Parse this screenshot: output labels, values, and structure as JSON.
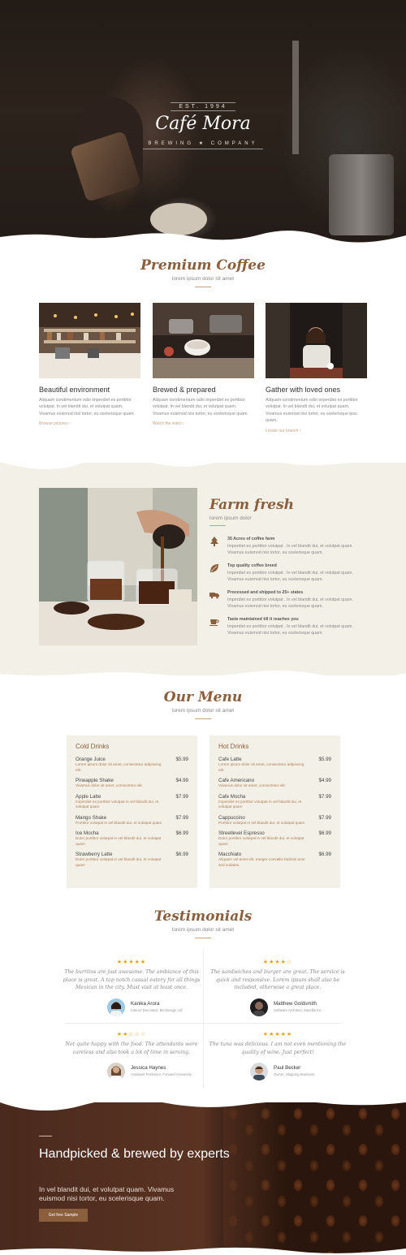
{
  "hero": {
    "est": "EST. 1994",
    "brand": "Café Mora",
    "brand_sub": "BREWING ★ COMPANY"
  },
  "premium": {
    "title": "Premium Coffee",
    "subtitle": "lorem ipsum dolor sit amet",
    "features": [
      {
        "title": "Beautiful environment",
        "text": "Aliquam condimentum odio imperdiet es porttitor volutpat. In vel blandit dui, et volutpat quam. Vivamus euismod nisi tortor, eu scelerisque quam.",
        "link": "Browse pictures ›"
      },
      {
        "title": "Brewed & prepared",
        "text": "Aliquam condimentum odio imperdiet es porttitor volutpat. In vel blandit dui, et volutpat quam. Vivamus euismod nisi tortor, eu scelerisque quam.",
        "link": "Watch the video ›"
      },
      {
        "title": "Gather with loved ones",
        "text": "Aliquam condimentum odio imperdiet es porttitor volutpat. In vel blandit dui, et volutpat quam. Vivamus euismod nisi tortor, eu scelerisque ipsu quam.",
        "link": "Locate our branch ›"
      }
    ]
  },
  "farm": {
    "title": "Farm fresh",
    "subtitle": "lorem ipsum dolor",
    "items": [
      {
        "icon": "tree-icon",
        "title": "35 Acres of coffee farm",
        "text": "Imperdiet es porttitor volutpat . In vel blandit dui, et volutpat quam. Vivamus euismod nisi tortor, eu scelerisque quam."
      },
      {
        "icon": "leaf-icon",
        "title": "Top quality coffee breed",
        "text": "Imperdiet es porttitor volutpat . In vel blandit dui, et volutpat quam. Vivamus euismod nisi tortor, eu scelerisque quam."
      },
      {
        "icon": "truck-icon",
        "title": "Processed and shipped to 25+ states",
        "text": "Imperdiet es porttitor volutpat . In vel blandit dui, et volutpat quam. Vivamus euismod nisi tortor, eu scelerisque quam."
      },
      {
        "icon": "cup-icon",
        "title": "Taste maintained till it reaches you",
        "text": "Imperdiet es porttitor volutpat . In vel blandit dui, et volutpat quam. Vivamus euismod nisi tortor, eu scelerisque quam."
      }
    ]
  },
  "menu": {
    "title": "Our Menu",
    "subtitle": "lorem ipsum dolor sit amet",
    "cold": {
      "heading": "Cold Drinks",
      "items": [
        {
          "name": "Orange Juice",
          "price": "$5.99",
          "desc": "Lorem ipsum dolor sit amet, consectetur adipiscing elit."
        },
        {
          "name": "Pineapple Shake",
          "price": "$4.99",
          "desc": "Vivamus dolor sit amet, consectetur elit."
        },
        {
          "name": "Apple Latte",
          "price": "$7.99",
          "desc": "Imperdiet es porttitor volutpat in vel blandit dui, et volutpat quam"
        },
        {
          "name": "Mango Shake",
          "price": "$7.99",
          "desc": "Porttitor volutpat in vel blandit dui, et volutpat quam"
        },
        {
          "name": "Ice Mocha",
          "price": "$6.99",
          "desc": "Dolor porttitor volutpat in vel blandit dui, et volutpat quam"
        },
        {
          "name": "Strawberry Latte",
          "price": "$6.99",
          "desc": "Dolor porttitor volutpat in vel blandit dui, et volutpat quam"
        }
      ]
    },
    "hot": {
      "heading": "Hot Drinks",
      "items": [
        {
          "name": "Cafe Latte",
          "price": "$5.99",
          "desc": "Lorem ipsum dolor sit amet, consectetur adipiscing elit."
        },
        {
          "name": "Cafe Americano",
          "price": "$4.99",
          "desc": "Vivamus dolor sit amet, consectetur elit."
        },
        {
          "name": "Cafe Mocha",
          "price": "$7.99",
          "desc": "Imperdiet es porttitor volutpat in vel blandit dui, et volutpat quam"
        },
        {
          "name": "Cappuccino",
          "price": "$7.99",
          "desc": "Porttitor volutpat in vel blandit dui, et volutpat quam"
        },
        {
          "name": "Streetlevel Espresso",
          "price": "$6.99",
          "desc": "Dolor porttitor volutpat in vel blandit dui, et volutpat quam"
        },
        {
          "name": "Macchiato",
          "price": "$6.99",
          "desc": "Aliquam vel amet elit. Integer convallis facilisis ante sed sodales."
        }
      ]
    }
  },
  "testimonials": {
    "title": "Testimonials",
    "subtitle": "lorem ipsum dolor sit amet",
    "items": [
      {
        "stars": "★★★★★",
        "quote": "The burritos are just awesome. The ambiance of this place is great. A top notch casual eatery for all things Mexican in the city. Must visit at least once.",
        "name": "Kanika Arora",
        "role": "Interior Decorator, Bio Design Ltd"
      },
      {
        "stars": "★★★★☆",
        "quote": "The sandwiches and burger are great. The service is quick and responsive. Lorem ipsum shall also be included, otherwise a great place.",
        "name": "Matthew Goldsmith",
        "role": "Software Architect, Zanzilla Inc."
      },
      {
        "stars": "★★☆☆☆",
        "quote": "Not quite happy with the food. The attendants were careless and also took a lot of time in serving.",
        "name": "Jessica Haynes",
        "role": "Assistant Professor, Forward University"
      },
      {
        "stars": "★★★★★",
        "quote": "The tuna was delicious. I am not even mentioning the quality of wine. Just perfect!",
        "name": "Paul Becker",
        "role": "Owner, Shipping Business"
      }
    ]
  },
  "cta": {
    "heading": "Handpicked & brewed by experts",
    "text": "In vel blandit dui, et volutpat quam. Vivamus euismod nisi tortor, eu scelerisque quam.",
    "button": "Get free Sample"
  },
  "colors": {
    "accent": "#8b5e3c",
    "cream": "#f3f1e7",
    "star": "#e2a51d",
    "dark": "#4a2a1e"
  }
}
